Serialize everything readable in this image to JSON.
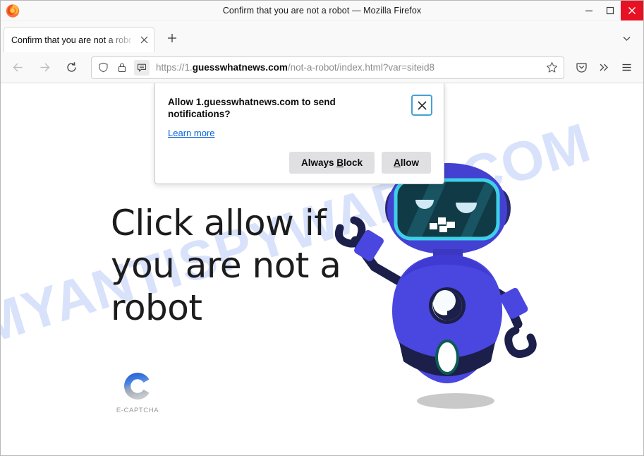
{
  "window": {
    "title": "Confirm that you are not a robot — Mozilla Firefox",
    "minimize_label": "—",
    "maximize_label": "□",
    "close_label": "✕"
  },
  "tabs": {
    "active": {
      "label": "Confirm that you are not a robot",
      "close_label": "✕"
    },
    "new_tab_label": "+",
    "tab_list_label": "⌄"
  },
  "toolbar": {
    "back_label": "←",
    "forward_label": "→",
    "reload_label": "⟳",
    "url": {
      "scheme": "https://1.",
      "host": "guesswhatnews.com",
      "path": "/not-a-robot/index.html?var=siteid8",
      "full": "https://1.guesswhatnews.com/not-a-robot/index.html?var=siteid8"
    },
    "pocket_label": "pocket-icon",
    "overflow_label": "»",
    "menu_label": "☰"
  },
  "notification": {
    "title": "Allow 1.guesswhatnews.com to send notifications?",
    "learn_more": "Learn more",
    "close_label": "✕",
    "buttons": {
      "always_block_pre": "Always ",
      "always_block_key": "B",
      "always_block_post": "lock",
      "allow_key": "A",
      "allow_post": "llow"
    }
  },
  "page": {
    "headline": "Click allow if you are not a robot",
    "watermark": "MYANTISPYWARE.COM",
    "captcha": {
      "label": "E-CAPTCHA"
    }
  },
  "colors": {
    "accent_blue": "#0060df",
    "close_red": "#e81123",
    "robot_body": "#4040d8",
    "robot_head": "#4340d2",
    "robot_dark": "#161a42",
    "visor_border": "#3ed0e8",
    "visor_fill": "#103b46",
    "watermark_blue": "#d9e2fb",
    "captcha_blue": "#2a62d8",
    "captcha_gray": "#c4c7cc"
  }
}
